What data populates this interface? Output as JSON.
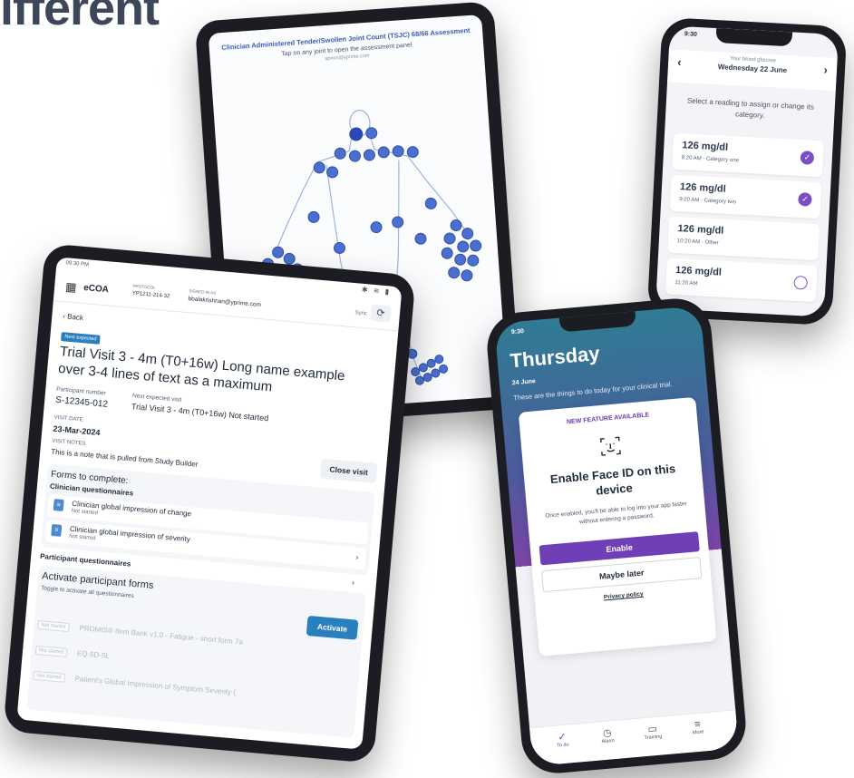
{
  "headline": "ifferent",
  "joint_tablet": {
    "title": "Clinician Administered Tender/Swollen Joint Count (TSJC) 68/66 Assessment",
    "subtitle": "Tap on any joint to open the assessment panel",
    "email": "apriori@yprime.com"
  },
  "glucose_phone": {
    "time": "9:30",
    "label": "Your blood glucose",
    "date": "Wednesday 22 June",
    "prev": "‹",
    "next": "›",
    "instruction": "Select a reading to assign or change its category.",
    "readings": [
      {
        "value": "126 mg/dl",
        "meta": "8:20 AM - Category one",
        "checked": true
      },
      {
        "value": "126 mg/dl",
        "meta": "9:20 AM - Category two",
        "checked": true
      },
      {
        "value": "126 mg/dl",
        "meta": "10:20 AM - Other",
        "checked": false
      },
      {
        "value": "126 mg/dl",
        "meta": "11:20 AM",
        "checked": false
      }
    ],
    "accent": "#7a4fc6"
  },
  "ecoa_tablet": {
    "status_time": "09:30 PM",
    "app_name": "eCOA",
    "protocol_label": "PROTOCOL",
    "protocol_value": "YP1211-214-32",
    "signed_label": "SIGNED IN AS",
    "signed_value": "bbalakrishnan@yprime.com",
    "sync_label": "Sync",
    "back": "‹ Back",
    "badge": "Next expected",
    "visit_title": "Trial Visit 3 - 4m (T0+16w) Long name example over 3-4 lines of text as a maximum",
    "participant_label": "Participant number",
    "participant_value": "S-12345-012",
    "next_visit_label": "Next expected visit",
    "next_visit_value": "Trial Visit 3 - 4m (T0+16w) Not started",
    "visit_date_label": "VISIT DATE",
    "visit_date_value": "23-Mar-2024",
    "visit_notes_label": "VISIT NOTES",
    "visit_notes_value": "This is a note that is pulled from Study Builder",
    "close_visit": "Close visit",
    "forms_heading": "Forms to complete:",
    "clinician_heading": "Clinician questionnaires",
    "clinician_forms": [
      {
        "name": "Clinician global impression of change",
        "status": "Not started"
      },
      {
        "name": "Clinician global impression of severity",
        "status": "Not started"
      }
    ],
    "participant_heading": "Participant questionnaires",
    "activate_heading": "Activate participant forms",
    "activate_sub": "Toggle to activate all questionnaires",
    "activate_btn": "Activate",
    "participant_forms": [
      {
        "status": "Not started",
        "name": "PROMIS® Item Bank v1.0 - Fatigue - short form 7a"
      },
      {
        "status": "Not started",
        "name": "EQ-5D-5L"
      },
      {
        "status": "Not started",
        "name": "Patient's Global Impression of Symptom Severity ("
      }
    ],
    "accent": "#2a7fbf"
  },
  "today_phone": {
    "time": "9:30",
    "title": "Thursday",
    "date": "24 June",
    "description": "These are the things to do today for your clinical trial.",
    "new_feature": "NEW FEATURE AVAILABLE",
    "faceid_title": "Enable Face ID on this device",
    "faceid_desc": "Once enabled, you'll be able to log into your app faster without entering a password.",
    "enable": "Enable",
    "maybe_later": "Maybe later",
    "privacy": "Privacy policy",
    "tabs": [
      {
        "label": "To do",
        "icon": "check-icon"
      },
      {
        "label": "Alarm",
        "icon": "clock-icon"
      },
      {
        "label": "Training",
        "icon": "book-icon"
      },
      {
        "label": "More",
        "icon": "menu-icon"
      }
    ],
    "accent": "#6e3fb6"
  }
}
